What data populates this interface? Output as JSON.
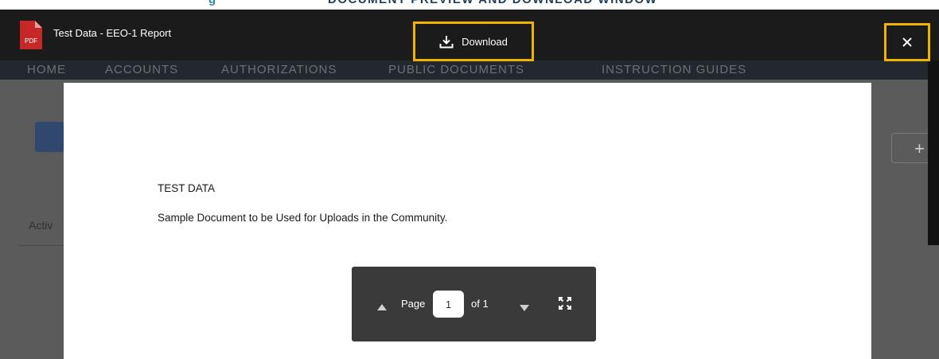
{
  "caption": {
    "figure_label": "g",
    "text": "DOCUMENT PREVIEW AND DOWNLOAD WINDOW"
  },
  "background_app": {
    "nav_items": [
      "HOME",
      "ACCOUNTS",
      "AUTHORIZATIONS",
      "PUBLIC DOCUMENTS",
      "INSTRUCTION GUIDES"
    ],
    "partial_tab_label": "Activ",
    "plus_label": "+"
  },
  "viewer": {
    "file_type_badge": "PDF",
    "file_title": "Test Data - EEO-1 Report",
    "download_label": "Download",
    "close_icon": "close-icon",
    "highlight_color": "#f0b400",
    "header_color": "#1b1b1b"
  },
  "document": {
    "title": "TEST DATA",
    "body": "Sample Document to be Used for Uploads in the Community."
  },
  "pager": {
    "page_label": "Page",
    "current_page": "1",
    "total_label": "of 1",
    "prev_icon": "triangle-up-icon",
    "next_icon": "triangle-down-icon",
    "fit_icon": "fit-to-page-icon"
  }
}
